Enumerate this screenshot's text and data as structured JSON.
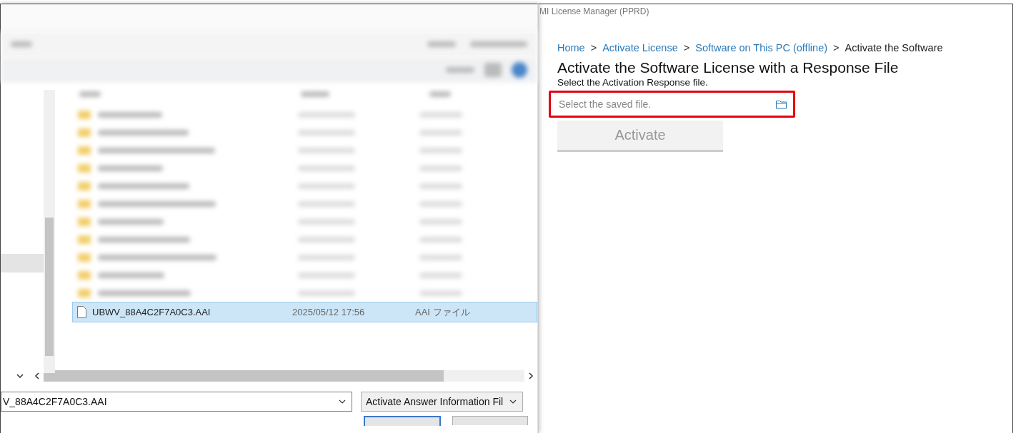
{
  "file_dialog": {
    "file_row": {
      "name": "UBWV_88A4C2F7A0C3.AAI",
      "date": "2025/05/12 17:56",
      "type": "AAI ファイル",
      "selected": true
    },
    "filename_field": {
      "value": "V_88A4C2F7A0C3.AAI"
    },
    "file_type_dropdown": {
      "value": "Activate Answer Information Fil"
    }
  },
  "app_window": {
    "title": "MI License Manager (PPRD)",
    "breadcrumb": [
      {
        "label": "Home",
        "kind": "link"
      },
      {
        "label": "Activate License",
        "kind": "link"
      },
      {
        "label": "Software on This PC (offline)",
        "kind": "link"
      },
      {
        "label": "Activate the Software",
        "kind": "current"
      }
    ],
    "breadcrumb_separators": [
      ">",
      ">",
      ">"
    ],
    "heading": "Activate the Software License with a Response File",
    "instruction": "Select the Activation Response file.",
    "file_field": {
      "placeholder": "Select the saved file.",
      "highlighted": true
    },
    "activate_button": {
      "label": "Activate",
      "disabled": true
    }
  }
}
